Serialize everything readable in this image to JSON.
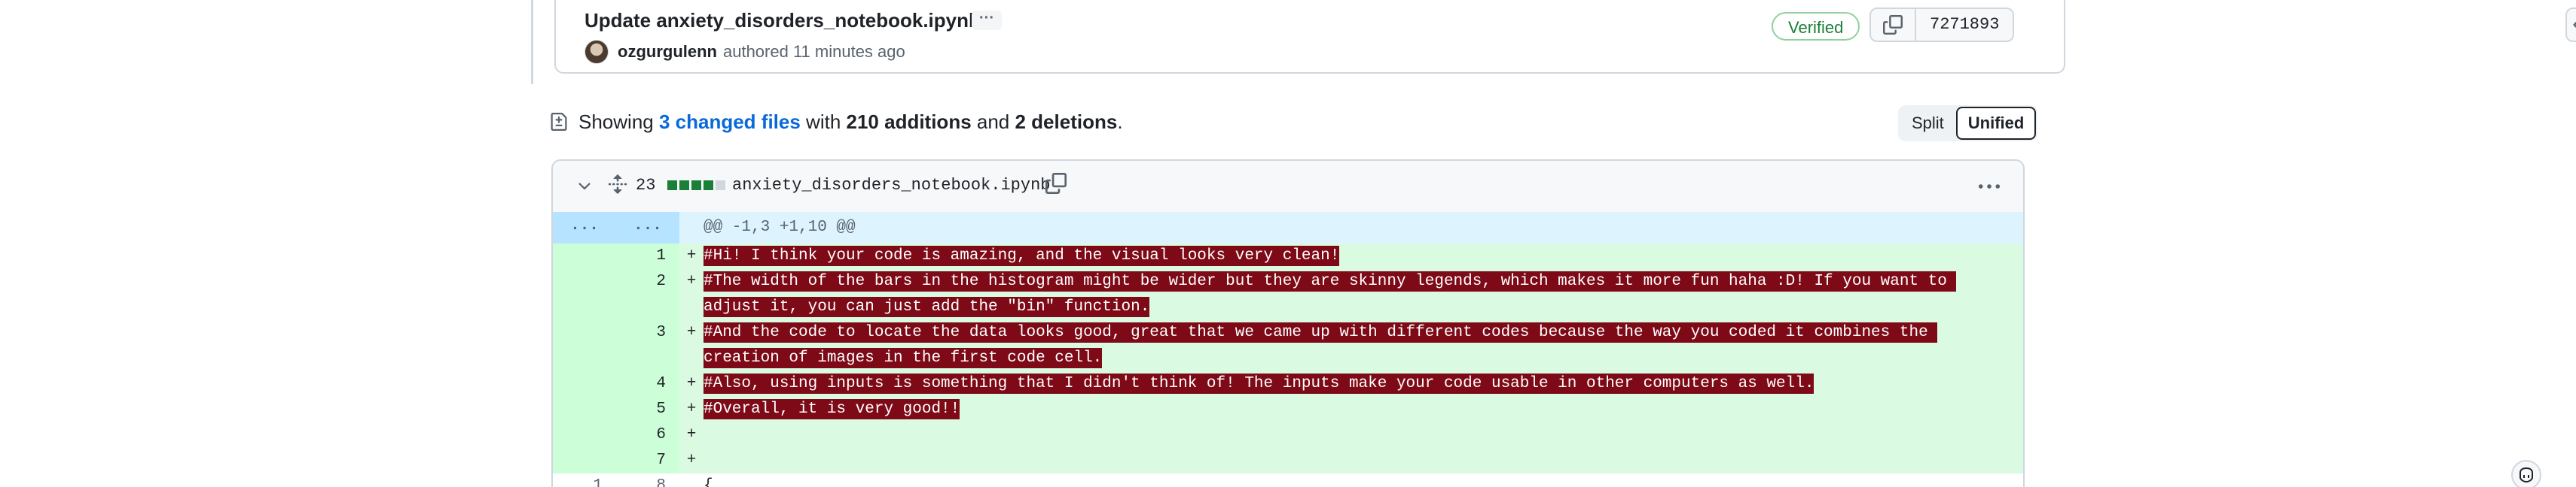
{
  "commit": {
    "title": "Update anxiety_disorders_notebook.ipynb",
    "ellipsis": "···",
    "author": "ozgurgulenn",
    "authored_text": "authored 11 minutes ago",
    "verified_label": "Verified",
    "sha": "7271893"
  },
  "summary": {
    "prefix": "Showing ",
    "changed_files": "3 changed files",
    "with": " with ",
    "additions": "210 additions",
    "and": " and ",
    "deletions": "2 deletions",
    "suffix": "."
  },
  "view_toggle": {
    "split": "Split",
    "unified": "Unified",
    "selected": "Unified"
  },
  "file": {
    "change_count": "23",
    "filename": "anxiety_disorders_notebook.ipynb",
    "diffstat_colors": [
      "#1a7f37",
      "#1a7f37",
      "#1a7f37",
      "#1a7f37",
      "#d0d7de"
    ],
    "hunk_old": "...",
    "hunk_new": "...",
    "hunk_header": "@@ -1,3 +1,10 @@",
    "lines": [
      {
        "num": "1",
        "marker": "+",
        "text": "#Hi! I think your code is amazing, and the visual looks very clean!"
      },
      {
        "num": "2",
        "marker": "+",
        "text": "#The width of the bars in the histogram might be wider but they are skinny legends, which makes it more fun haha :D! If you want to adjust it, you can just add the \"bin\" function."
      },
      {
        "num": "3",
        "marker": "+",
        "text": "#And the code to locate the data looks good, great that we came up with different codes because the way you coded it combines the creation of images in the first code cell."
      },
      {
        "num": "4",
        "marker": "+",
        "text": "#Also, using inputs is something that I didn't think of! The inputs make your code usable in other computers as well."
      },
      {
        "num": "5",
        "marker": "+",
        "text": "#Overall, it is very good!!"
      },
      {
        "num": "6",
        "marker": "+",
        "text": ""
      },
      {
        "num": "7",
        "marker": "+",
        "text": ""
      }
    ],
    "partial_line": {
      "old": "1",
      "new": "8",
      "text": "{"
    }
  },
  "colors": {
    "added_bg": "#dafbe1",
    "added_gutter": "#ccffd8",
    "highlight_bg": "#7d0a16",
    "link": "#0969da",
    "verified": "#1a7f37"
  }
}
